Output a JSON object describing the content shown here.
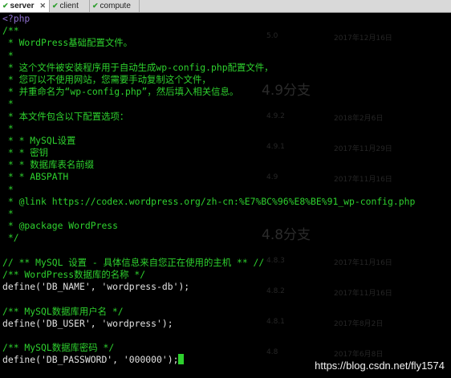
{
  "tabs": [
    {
      "label": "server",
      "active": true
    },
    {
      "label": "client",
      "active": false
    },
    {
      "label": "compute",
      "active": false
    }
  ],
  "background_headings": [
    {
      "text": "4.9分支"
    },
    {
      "text": "4.8分支"
    }
  ],
  "background_versions": [
    {
      "version": "5.0",
      "date": "2017年12月16日"
    },
    {
      "version": "4.9.2",
      "date": "2018年2月6日"
    },
    {
      "version": "4.9.1",
      "date": "2017年11月29日"
    },
    {
      "version": "4.9",
      "date": "2017年11月16日"
    },
    {
      "version": "4.8.3",
      "date": "2017年11月16日"
    },
    {
      "version": "4.8.2",
      "date": "2017年11月16日"
    },
    {
      "version": "4.8.1",
      "date": "2017年8月2日"
    },
    {
      "version": "4.8",
      "date": "2017年6月8日"
    }
  ],
  "code_lines": [
    {
      "text": "<?php",
      "color": "purple"
    },
    {
      "text": "/**",
      "color": "green"
    },
    {
      "text": " * WordPress基础配置文件。",
      "color": "green"
    },
    {
      "text": " *",
      "color": "green"
    },
    {
      "text": " * 这个文件被安装程序用于自动生成wp-config.php配置文件，",
      "color": "green"
    },
    {
      "text": " * 您可以不使用网站，您需要手动复制这个文件，",
      "color": "green"
    },
    {
      "text": " * 并重命名为“wp-config.php”，然后填入相关信息。",
      "color": "green"
    },
    {
      "text": " *",
      "color": "green"
    },
    {
      "text": " * 本文件包含以下配置选项：",
      "color": "green"
    },
    {
      "text": " *",
      "color": "green"
    },
    {
      "text": " * * MySQL设置",
      "color": "green"
    },
    {
      "text": " * * 密钥",
      "color": "green"
    },
    {
      "text": " * * 数据库表名前缀",
      "color": "green"
    },
    {
      "text": " * * ABSPATH",
      "color": "green"
    },
    {
      "text": " *",
      "color": "green"
    },
    {
      "text": " * @link https://codex.wordpress.org/zh-cn:%E7%BC%96%E8%BE%91_wp-config.php",
      "color": "green"
    },
    {
      "text": " *",
      "color": "green"
    },
    {
      "text": " * @package WordPress",
      "color": "green"
    },
    {
      "text": " */",
      "color": "green"
    },
    {
      "text": "",
      "color": "green"
    },
    {
      "text": "// ** MySQL 设置 - 具体信息来自您正在使用的主机 ** //",
      "color": "green"
    },
    {
      "text": "/** WordPress数据库的名称 */",
      "color": "green"
    },
    {
      "text": "define('DB_NAME', 'wordpress-db');",
      "color": "white"
    },
    {
      "text": "",
      "color": "white"
    },
    {
      "text": "/** MySQL数据库用户名 */",
      "color": "green"
    },
    {
      "text": "define('DB_USER', 'wordpress');",
      "color": "white"
    },
    {
      "text": "",
      "color": "white"
    },
    {
      "text": "/** MySQL数据库密码 */",
      "color": "green"
    },
    {
      "text": "define('DB_PASSWORD', '000000');",
      "color": "white"
    }
  ],
  "watermark": "https://blog.csdn.net/fly1574",
  "colors": {
    "background": "#000000",
    "comment": "#2ed12e",
    "code": "#e2e2e2",
    "php_tag": "#8e6fcf",
    "cursor": "#2ed12e"
  },
  "icons": {
    "tab_status": "checkmark-icon",
    "tab_close": "close-icon"
  }
}
